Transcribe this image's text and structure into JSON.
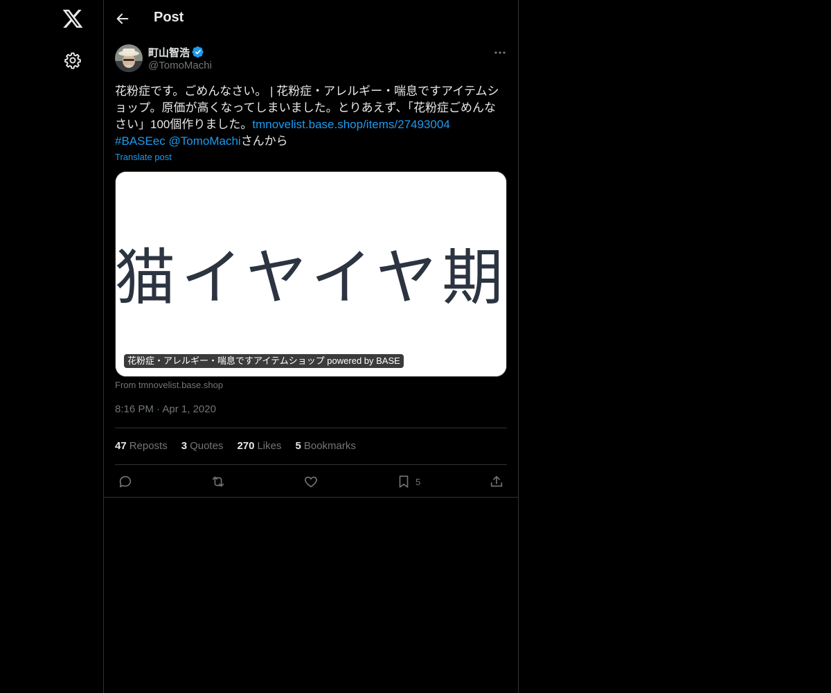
{
  "nav": {
    "logo_icon": "x-logo-icon",
    "settings_icon": "gear-icon"
  },
  "header": {
    "title": "Post",
    "back_icon": "arrow-left-icon"
  },
  "post": {
    "author_name": "町山智浩",
    "handle": "@TomoMachi",
    "verified": true,
    "text_lines": [
      "花粉症です。ごめんなさい。 | 花粉症・アレルギー・喘息ですアイテムシ",
      "ョップ。原価が高くなってしまいました。とりあえず、「花粉症ごめんな",
      "さい」100個作りました。"
    ],
    "link_url": "tmnovelist.base.shop/items/27493004",
    "hashtag": "#BASEec",
    "mention": "@TomoMachi",
    "suffix": "さんから",
    "translate": "Translate post",
    "card": {
      "image_text": "猫イヤイヤ期",
      "label": "花粉症・アレルギー・喘息ですアイテムショップ powered by BASE",
      "from": "From tmnovelist.base.shop"
    },
    "time": "8:16 PM",
    "separator": "·",
    "date": "Apr 1, 2020",
    "stats": [
      {
        "num": "47",
        "label": "Reposts"
      },
      {
        "num": "3",
        "label": "Quotes"
      },
      {
        "num": "270",
        "label": "Likes"
      },
      {
        "num": "5",
        "label": "Bookmarks"
      }
    ],
    "actions": {
      "reply_icon": "reply-icon",
      "repost_icon": "repost-icon",
      "like_icon": "heart-icon",
      "bookmark_icon": "bookmark-icon",
      "bookmark_count": "5",
      "share_icon": "share-icon"
    }
  },
  "colors": {
    "accent": "#1d9bf0",
    "muted": "#71767b",
    "text": "#e7e9ea",
    "border": "#2f3336"
  }
}
